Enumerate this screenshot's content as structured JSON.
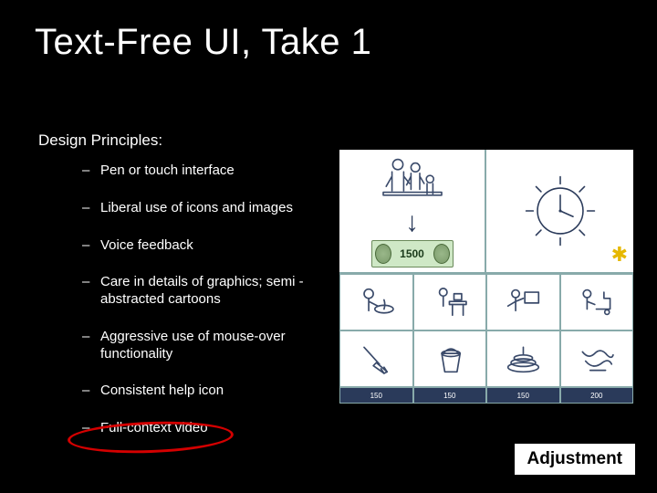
{
  "title": "Text-Free UI, Take 1",
  "subhead": "Design Principles:",
  "bullets": [
    "Pen or touch interface",
    "Liberal use of icons and images",
    "Voice feedback",
    "Care in details of graphics; semi -abstracted cartoons",
    "Aggressive use of mouse-over functionality",
    "Consistent help icon",
    "Full-context video"
  ],
  "panel": {
    "money_amount": "1500",
    "arrow": "↓",
    "star": "✱",
    "captions": [
      "150",
      "150",
      "150",
      "200"
    ]
  },
  "button": "Adjustment"
}
